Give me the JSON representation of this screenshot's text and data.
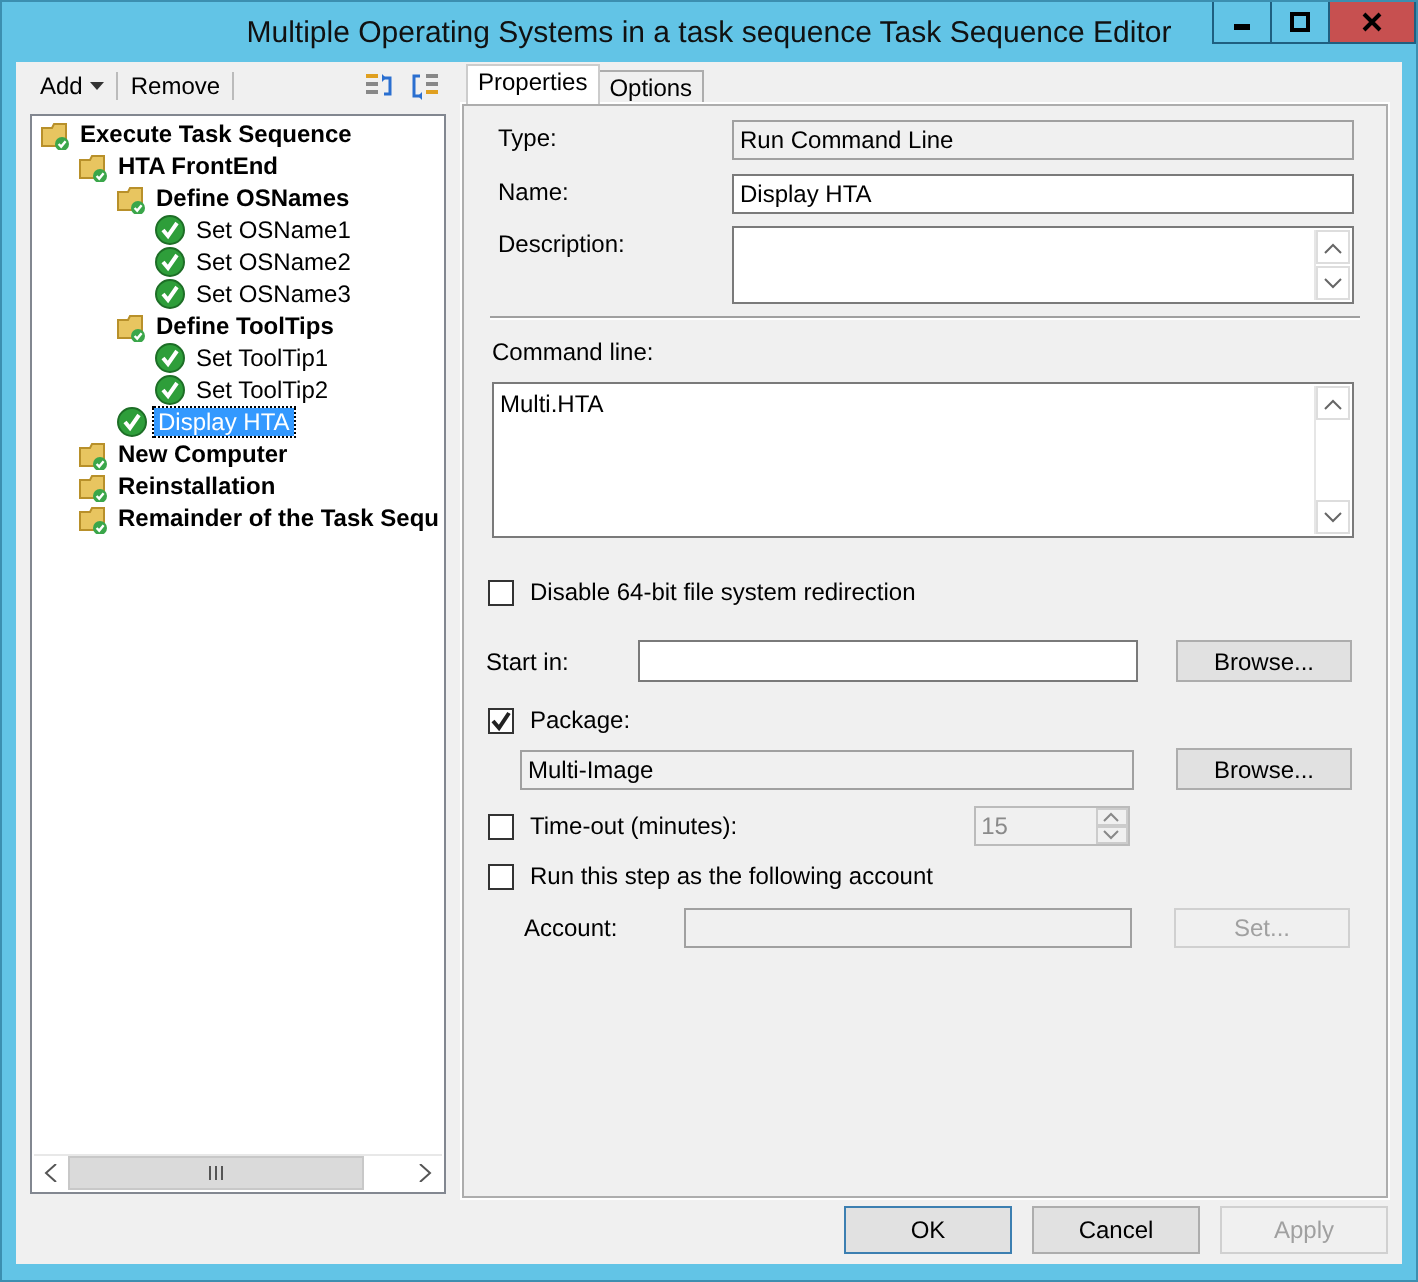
{
  "window": {
    "title": "Multiple Operating Systems in a task sequence Task Sequence Editor"
  },
  "toolbar": {
    "add": "Add",
    "remove": "Remove"
  },
  "tree": [
    {
      "label": "Execute Task Sequence",
      "kind": "group",
      "selected": false,
      "children": [
        {
          "label": "HTA FrontEnd",
          "kind": "group",
          "selected": false,
          "children": [
            {
              "label": "Define OSNames",
              "kind": "group",
              "selected": false,
              "children": [
                {
                  "label": "Set OSName1",
                  "kind": "step",
                  "selected": false
                },
                {
                  "label": "Set OSName2",
                  "kind": "step",
                  "selected": false
                },
                {
                  "label": "Set OSName3",
                  "kind": "step",
                  "selected": false
                }
              ]
            },
            {
              "label": "Define ToolTips",
              "kind": "group",
              "selected": false,
              "children": [
                {
                  "label": "Set ToolTip1",
                  "kind": "step",
                  "selected": false
                },
                {
                  "label": "Set ToolTip2",
                  "kind": "step",
                  "selected": false
                }
              ]
            },
            {
              "label": "Display HTA",
              "kind": "step",
              "selected": true
            }
          ]
        },
        {
          "label": "New Computer",
          "kind": "group",
          "selected": false
        },
        {
          "label": "Reinstallation",
          "kind": "group",
          "selected": false
        },
        {
          "label": "Remainder of the Task Sequ",
          "kind": "group",
          "selected": false
        }
      ]
    }
  ],
  "tabs": [
    {
      "label": "Properties",
      "selected": true
    },
    {
      "label": "Options",
      "selected": false
    }
  ],
  "form": {
    "type": {
      "label": "Type:",
      "value": "Run Command Line"
    },
    "name": {
      "label": "Name:",
      "value": "Display HTA"
    },
    "description": {
      "label": "Description:"
    },
    "command_line": {
      "label": "Command line:",
      "value": "Multi.HTA"
    },
    "disable_redirection": {
      "label": "Disable 64-bit file system redirection",
      "checked": false
    },
    "start_in": {
      "label": "Start in:",
      "button": "Browse..."
    },
    "package": {
      "label": "Package:",
      "checked": true,
      "value": "Multi-Image",
      "button": "Browse..."
    },
    "timeout": {
      "label": "Time-out (minutes):",
      "checked": false,
      "value": "15",
      "disabled": true
    },
    "run_as": {
      "label": "Run this step as the following account",
      "checked": false
    },
    "account": {
      "label": "Account:",
      "button": "Set...",
      "disabled": true
    }
  },
  "buttons": [
    {
      "label": "OK",
      "default": true,
      "disabled": false
    },
    {
      "label": "Cancel",
      "default": false,
      "disabled": false
    },
    {
      "label": "Apply",
      "default": false,
      "disabled": true
    }
  ]
}
